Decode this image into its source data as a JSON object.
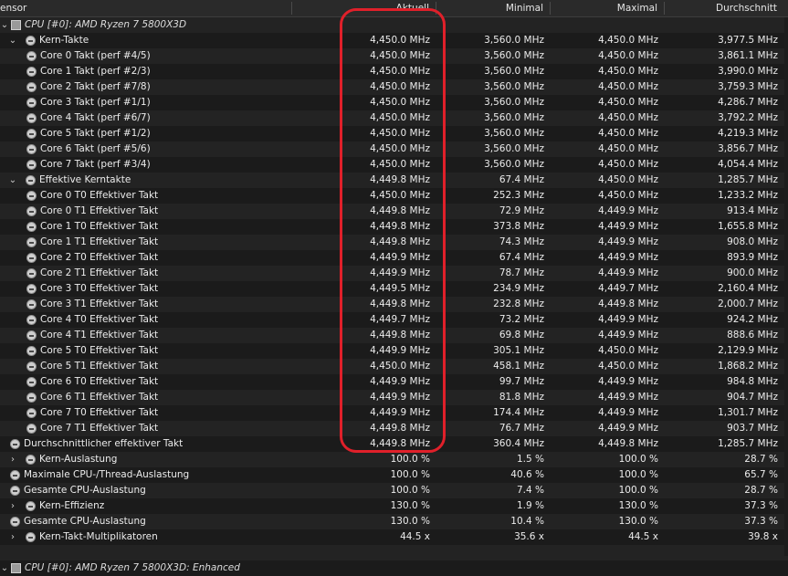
{
  "header": {
    "sensor": "ensor",
    "aktuell": "Aktuell",
    "minimal": "Minimal",
    "maximal": "Maximal",
    "durchschnitt": "Durchschnitt"
  },
  "rows": [
    {
      "kind": "group",
      "name": "CPU [#0]: AMD Ryzen 7 5800X3D",
      "indent": 0
    },
    {
      "kind": "parent",
      "name": "Kern-Takte",
      "indent": 1,
      "expand": "down",
      "cur": "4,450.0 MHz",
      "min": "3,560.0 MHz",
      "max": "4,450.0 MHz",
      "avg": "3,977.5 MHz"
    },
    {
      "kind": "leaf",
      "name": "Core 0 Takt (perf #4/5)",
      "indent": 2,
      "cur": "4,450.0 MHz",
      "min": "3,560.0 MHz",
      "max": "4,450.0 MHz",
      "avg": "3,861.1 MHz"
    },
    {
      "kind": "leaf",
      "name": "Core 1 Takt (perf #2/3)",
      "indent": 2,
      "cur": "4,450.0 MHz",
      "min": "3,560.0 MHz",
      "max": "4,450.0 MHz",
      "avg": "3,990.0 MHz"
    },
    {
      "kind": "leaf",
      "name": "Core 2 Takt (perf #7/8)",
      "indent": 2,
      "cur": "4,450.0 MHz",
      "min": "3,560.0 MHz",
      "max": "4,450.0 MHz",
      "avg": "3,759.3 MHz"
    },
    {
      "kind": "leaf",
      "name": "Core 3 Takt (perf #1/1)",
      "indent": 2,
      "cur": "4,450.0 MHz",
      "min": "3,560.0 MHz",
      "max": "4,450.0 MHz",
      "avg": "4,286.7 MHz"
    },
    {
      "kind": "leaf",
      "name": "Core 4 Takt (perf #6/7)",
      "indent": 2,
      "cur": "4,450.0 MHz",
      "min": "3,560.0 MHz",
      "max": "4,450.0 MHz",
      "avg": "3,792.2 MHz"
    },
    {
      "kind": "leaf",
      "name": "Core 5 Takt (perf #1/2)",
      "indent": 2,
      "cur": "4,450.0 MHz",
      "min": "3,560.0 MHz",
      "max": "4,450.0 MHz",
      "avg": "4,219.3 MHz"
    },
    {
      "kind": "leaf",
      "name": "Core 6 Takt (perf #5/6)",
      "indent": 2,
      "cur": "4,450.0 MHz",
      "min": "3,560.0 MHz",
      "max": "4,450.0 MHz",
      "avg": "3,856.7 MHz"
    },
    {
      "kind": "leaf",
      "name": "Core 7 Takt (perf #3/4)",
      "indent": 2,
      "cur": "4,450.0 MHz",
      "min": "3,560.0 MHz",
      "max": "4,450.0 MHz",
      "avg": "4,054.4 MHz"
    },
    {
      "kind": "parent",
      "name": "Effektive Kerntakte",
      "indent": 1,
      "expand": "down",
      "cur": "4,449.8 MHz",
      "min": "67.4 MHz",
      "max": "4,450.0 MHz",
      "avg": "1,285.7 MHz"
    },
    {
      "kind": "leaf",
      "name": "Core 0 T0 Effektiver Takt",
      "indent": 2,
      "cur": "4,450.0 MHz",
      "min": "252.3 MHz",
      "max": "4,450.0 MHz",
      "avg": "1,233.2 MHz"
    },
    {
      "kind": "leaf",
      "name": "Core 0 T1 Effektiver Takt",
      "indent": 2,
      "cur": "4,449.8 MHz",
      "min": "72.9 MHz",
      "max": "4,449.9 MHz",
      "avg": "913.4 MHz"
    },
    {
      "kind": "leaf",
      "name": "Core 1 T0 Effektiver Takt",
      "indent": 2,
      "cur": "4,449.8 MHz",
      "min": "373.8 MHz",
      "max": "4,449.9 MHz",
      "avg": "1,655.8 MHz"
    },
    {
      "kind": "leaf",
      "name": "Core 1 T1 Effektiver Takt",
      "indent": 2,
      "cur": "4,449.8 MHz",
      "min": "74.3 MHz",
      "max": "4,449.9 MHz",
      "avg": "908.0 MHz"
    },
    {
      "kind": "leaf",
      "name": "Core 2 T0 Effektiver Takt",
      "indent": 2,
      "cur": "4,449.9 MHz",
      "min": "67.4 MHz",
      "max": "4,449.9 MHz",
      "avg": "893.9 MHz"
    },
    {
      "kind": "leaf",
      "name": "Core 2 T1 Effektiver Takt",
      "indent": 2,
      "cur": "4,449.9 MHz",
      "min": "78.7 MHz",
      "max": "4,449.9 MHz",
      "avg": "900.0 MHz"
    },
    {
      "kind": "leaf",
      "name": "Core 3 T0 Effektiver Takt",
      "indent": 2,
      "cur": "4,449.5 MHz",
      "min": "234.9 MHz",
      "max": "4,449.7 MHz",
      "avg": "2,160.4 MHz"
    },
    {
      "kind": "leaf",
      "name": "Core 3 T1 Effektiver Takt",
      "indent": 2,
      "cur": "4,449.8 MHz",
      "min": "232.8 MHz",
      "max": "4,449.8 MHz",
      "avg": "2,000.7 MHz"
    },
    {
      "kind": "leaf",
      "name": "Core 4 T0 Effektiver Takt",
      "indent": 2,
      "cur": "4,449.7 MHz",
      "min": "73.2 MHz",
      "max": "4,449.9 MHz",
      "avg": "924.2 MHz"
    },
    {
      "kind": "leaf",
      "name": "Core 4 T1 Effektiver Takt",
      "indent": 2,
      "cur": "4,449.8 MHz",
      "min": "69.8 MHz",
      "max": "4,449.9 MHz",
      "avg": "888.6 MHz"
    },
    {
      "kind": "leaf",
      "name": "Core 5 T0 Effektiver Takt",
      "indent": 2,
      "cur": "4,449.9 MHz",
      "min": "305.1 MHz",
      "max": "4,450.0 MHz",
      "avg": "2,129.9 MHz"
    },
    {
      "kind": "leaf",
      "name": "Core 5 T1 Effektiver Takt",
      "indent": 2,
      "cur": "4,450.0 MHz",
      "min": "458.1 MHz",
      "max": "4,450.0 MHz",
      "avg": "1,868.2 MHz"
    },
    {
      "kind": "leaf",
      "name": "Core 6 T0 Effektiver Takt",
      "indent": 2,
      "cur": "4,449.9 MHz",
      "min": "99.7 MHz",
      "max": "4,449.9 MHz",
      "avg": "984.8 MHz"
    },
    {
      "kind": "leaf",
      "name": "Core 6 T1 Effektiver Takt",
      "indent": 2,
      "cur": "4,449.9 MHz",
      "min": "81.8 MHz",
      "max": "4,449.9 MHz",
      "avg": "904.7 MHz"
    },
    {
      "kind": "leaf",
      "name": "Core 7 T0 Effektiver Takt",
      "indent": 2,
      "cur": "4,449.9 MHz",
      "min": "174.4 MHz",
      "max": "4,449.9 MHz",
      "avg": "1,301.7 MHz"
    },
    {
      "kind": "leaf",
      "name": "Core 7 T1 Effektiver Takt",
      "indent": 2,
      "cur": "4,449.8 MHz",
      "min": "76.7 MHz",
      "max": "4,449.9 MHz",
      "avg": "903.7 MHz"
    },
    {
      "kind": "item",
      "name": "Durchschnittlicher effektiver Takt",
      "indent": 1,
      "cur": "4,449.8 MHz",
      "min": "360.4 MHz",
      "max": "4,449.8 MHz",
      "avg": "1,285.7 MHz"
    },
    {
      "kind": "parent",
      "name": "Kern-Auslastung",
      "indent": 1,
      "expand": "right",
      "cur": "100.0 %",
      "min": "1.5 %",
      "max": "100.0 %",
      "avg": "28.7 %"
    },
    {
      "kind": "item",
      "name": "Maximale CPU-/Thread-Auslastung",
      "indent": 1,
      "cur": "100.0 %",
      "min": "40.6 %",
      "max": "100.0 %",
      "avg": "65.7 %"
    },
    {
      "kind": "item",
      "name": "Gesamte CPU-Auslastung",
      "indent": 1,
      "cur": "100.0 %",
      "min": "7.4 %",
      "max": "100.0 %",
      "avg": "28.7 %"
    },
    {
      "kind": "parent",
      "name": "Kern-Effizienz",
      "indent": 1,
      "expand": "right",
      "cur": "130.0 %",
      "min": "1.9 %",
      "max": "130.0 %",
      "avg": "37.3 %"
    },
    {
      "kind": "item",
      "name": "Gesamte CPU-Auslastung",
      "indent": 1,
      "cur": "130.0 %",
      "min": "10.4 %",
      "max": "130.0 %",
      "avg": "37.3 %"
    },
    {
      "kind": "parent",
      "name": "Kern-Takt-Multiplikatoren",
      "indent": 1,
      "expand": "right",
      "cur": "44.5 x",
      "min": "35.6 x",
      "max": "44.5 x",
      "avg": "39.8 x"
    },
    {
      "kind": "blank",
      "name": "",
      "indent": 0
    },
    {
      "kind": "group",
      "name": "CPU [#0]: AMD Ryzen 7 5800X3D: Enhanced",
      "indent": 0
    }
  ],
  "colors": {
    "background": "#1c1c1c",
    "row_alt": "#232323",
    "header": "#2a2a2a",
    "text": "#ececec",
    "highlight": "#e0202a"
  }
}
